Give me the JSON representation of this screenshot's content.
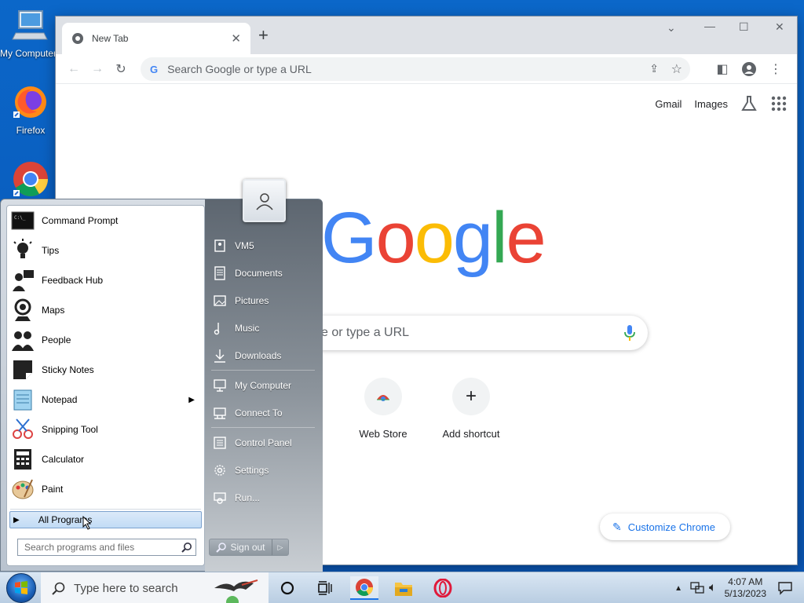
{
  "desktop": {
    "icons": [
      {
        "label": "My Computer",
        "icon": "computer-icon"
      },
      {
        "label": "Firefox",
        "icon": "firefox-icon"
      },
      {
        "label": "",
        "icon": "chrome-icon"
      }
    ]
  },
  "browser": {
    "tab_title": "New Tab",
    "new_tab_symbol": "+",
    "omnibox_placeholder": "Search Google or type a URL",
    "ntp": {
      "gmail": "Gmail",
      "images": "Images",
      "search_placeholder": "e or type a URL",
      "shortcuts": [
        {
          "label": "Web Store",
          "icon": "web-store-icon"
        },
        {
          "label": "Add shortcut",
          "icon": "plus-icon"
        }
      ],
      "customize": "Customize Chrome"
    },
    "logo_letters": [
      {
        "ch": "G",
        "color": "#4285f4"
      },
      {
        "ch": "o",
        "color": "#ea4335"
      },
      {
        "ch": "o",
        "color": "#fbbc05"
      },
      {
        "ch": "g",
        "color": "#4285f4"
      },
      {
        "ch": "l",
        "color": "#34a853"
      },
      {
        "ch": "e",
        "color": "#ea4335"
      }
    ]
  },
  "start_menu": {
    "programs": [
      {
        "label": "Command Prompt",
        "icon": "command-prompt-icon"
      },
      {
        "label": "Tips",
        "icon": "lightbulb-icon"
      },
      {
        "label": "Feedback Hub",
        "icon": "feedback-icon"
      },
      {
        "label": "Maps",
        "icon": "maps-icon"
      },
      {
        "label": "People",
        "icon": "people-icon"
      },
      {
        "label": "Sticky Notes",
        "icon": "sticky-notes-icon"
      },
      {
        "label": "Notepad",
        "icon": "notepad-icon",
        "has_submenu": true
      },
      {
        "label": "Snipping Tool",
        "icon": "scissors-icon"
      },
      {
        "label": "Calculator",
        "icon": "calculator-icon"
      },
      {
        "label": "Paint",
        "icon": "paint-palette-icon"
      }
    ],
    "all_programs": "All Programs",
    "search_placeholder": "Search programs and files",
    "places": [
      {
        "label": "VM5",
        "icon": "user-folder-icon"
      },
      {
        "label": "Documents",
        "icon": "documents-icon"
      },
      {
        "label": "Pictures",
        "icon": "pictures-icon"
      },
      {
        "label": "Music",
        "icon": "music-icon"
      },
      {
        "label": "Downloads",
        "icon": "downloads-icon"
      },
      {
        "label": "My Computer",
        "icon": "computer-icon"
      },
      {
        "label": "Connect To",
        "icon": "connect-icon"
      },
      {
        "label": "Control Panel",
        "icon": "control-panel-icon"
      },
      {
        "label": "Settings",
        "icon": "gear-icon"
      },
      {
        "label": "Run...",
        "icon": "run-icon"
      }
    ],
    "sign_out": "Sign out"
  },
  "taskbar": {
    "search_placeholder": "Type here to search",
    "time": "4:07 AM",
    "date": "5/13/2023"
  }
}
